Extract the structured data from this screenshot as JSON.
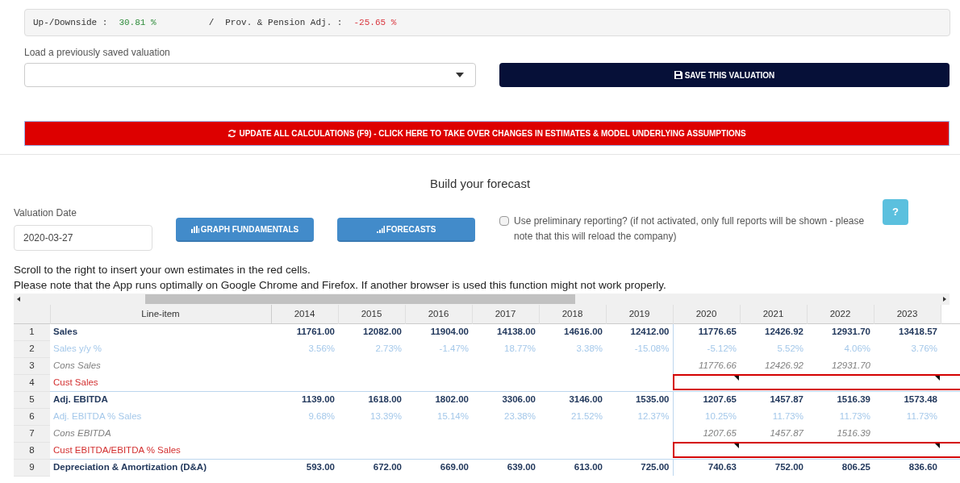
{
  "summary": {
    "updown_label": "Up-/Downside :",
    "updown_value": "30.81 %",
    "separator": "/",
    "pension_label": "Prov. & Pension Adj. :",
    "pension_value": "-25.65 %"
  },
  "load": {
    "label": "Load a previously saved valuation"
  },
  "save_button": "SAVE THIS VALUATION",
  "update_button": "UPDATE ALL CALCULATIONS (F9) - CLICK HERE TO TAKE OVER CHANGES IN ESTIMATES & MODEL UNDERLYING ASSUMPTIONS",
  "heading": "Build your forecast",
  "valuation_date": {
    "label": "Valuation Date",
    "value": "2020-03-27"
  },
  "buttons": [
    {
      "kind": "graph",
      "label": "GRAPH FUNDAMENTALS"
    },
    {
      "kind": "forecast",
      "label": "FORECASTS"
    }
  ],
  "preliminary": {
    "label": "Use preliminary reporting? (if not activated, only full reports will be shown - please note that this will reload the company)",
    "checked": false
  },
  "help_button": "?",
  "notes": [
    "Scroll to the right to insert your own estimates in the red cells.",
    "Please note that the App runs optimally on Google Chrome and Firefox. If another browser is used this function might not work properly."
  ],
  "table": {
    "line_item_header": "Line-item",
    "history_years": [
      "2014",
      "2015",
      "2016",
      "2017",
      "2018",
      "2019"
    ],
    "forecast_years": [
      "2020",
      "2021",
      "2022",
      "2023"
    ],
    "rows": [
      {
        "num": "1",
        "label": "Sales",
        "kind": "main",
        "history": [
          "11761.00",
          "12082.00",
          "11904.00",
          "14138.00",
          "14616.00",
          "12412.00"
        ],
        "forecast": [
          "11776.65",
          "12426.92",
          "12931.70",
          "13418.57"
        ]
      },
      {
        "num": "2",
        "label": "Sales y/y %",
        "kind": "ratio",
        "history": [
          "3.56%",
          "2.73%",
          "-1.47%",
          "18.77%",
          "3.38%",
          "-15.08%"
        ],
        "forecast": [
          "-5.12%",
          "5.52%",
          "4.06%",
          "3.76%"
        ]
      },
      {
        "num": "3",
        "label": "Cons Sales",
        "kind": "consensus",
        "forecast": [
          "11776.66",
          "12426.92",
          "12931.70"
        ]
      },
      {
        "num": "4",
        "label": "Cust Sales",
        "kind": "custom"
      },
      {
        "num": "5",
        "label": "Adj. EBITDA",
        "kind": "main",
        "history": [
          "1139.00",
          "1618.00",
          "1802.00",
          "3306.00",
          "3146.00",
          "1535.00"
        ],
        "forecast": [
          "1207.65",
          "1457.87",
          "1516.39",
          "1573.48"
        ]
      },
      {
        "num": "6",
        "label": "Adj. EBITDA % Sales",
        "kind": "ratio",
        "history": [
          "9.68%",
          "13.39%",
          "15.14%",
          "23.38%",
          "21.52%",
          "12.37%"
        ],
        "forecast": [
          "10.25%",
          "11.73%",
          "11.73%",
          "11.73%"
        ]
      },
      {
        "num": "7",
        "label": "Cons EBITDA",
        "kind": "consensus",
        "forecast": [
          "1207.65",
          "1457.87",
          "1516.39"
        ]
      },
      {
        "num": "8",
        "label": "Cust EBITDA/EBITDA % Sales",
        "kind": "custom"
      },
      {
        "num": "9",
        "label": "Depreciation & Amortization (D&A)",
        "kind": "main",
        "history": [
          "593.00",
          "672.00",
          "669.00",
          "639.00",
          "613.00",
          "725.00"
        ],
        "forecast": [
          "740.63",
          "752.00",
          "806.25",
          "836.60"
        ]
      }
    ]
  }
}
